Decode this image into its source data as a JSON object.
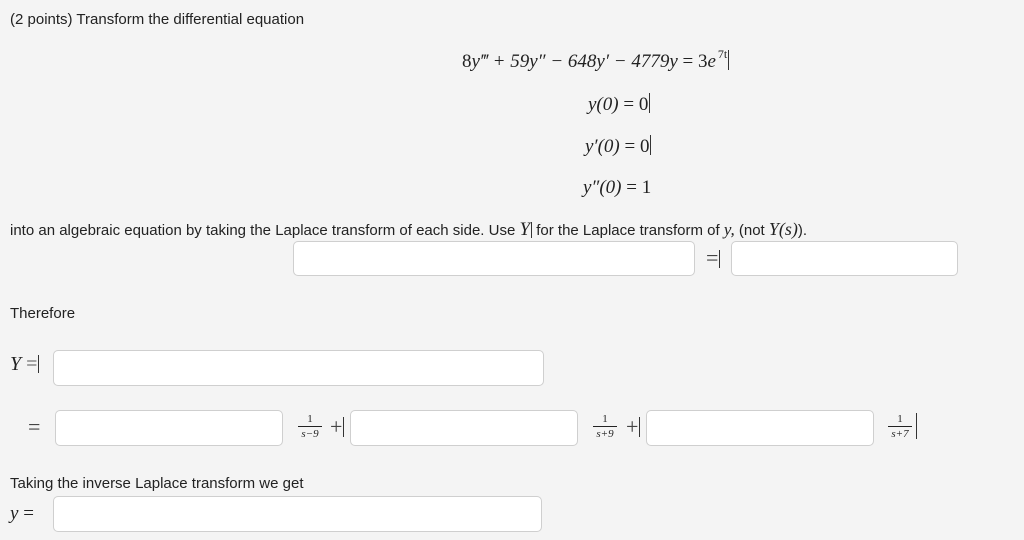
{
  "problem": {
    "intro": "(2 points) Transform the differential equation",
    "equation": {
      "lhs_a": "8",
      "lhs_b": "y‴ + 59",
      "lhs_c": "y″ − 648",
      "lhs_d": "y′ − 4779",
      "lhs_e": "y",
      "eq": " = 3",
      "rhs_e": "e",
      "exponent": "7t"
    },
    "conditions": [
      {
        "lhs": "y(0)",
        "rhs": "0"
      },
      {
        "lhs": "y′(0)",
        "rhs": "0"
      },
      {
        "lhs": "y″(0)",
        "rhs": "1"
      }
    ],
    "instruction_a": "into an algebraic equation by taking the Laplace transform of each side. Use",
    "instruction_Y": "Y",
    "instruction_b": "for the Laplace transform of",
    "instruction_y": "y,",
    "instruction_c": "(not",
    "instruction_Ys": "Y(s)",
    "instruction_d": ")."
  },
  "laplace_equation": {
    "lhs_value": "",
    "equals": "=",
    "rhs_value": ""
  },
  "therefore_label": "Therefore",
  "Y_row": {
    "label": "Y",
    "equals": "=",
    "value": ""
  },
  "partial_fractions": {
    "equals": "=",
    "terms": [
      {
        "value": "",
        "num": "1",
        "den": "s−9",
        "plus": "+"
      },
      {
        "value": "",
        "num": "1",
        "den": "s+9",
        "plus": "+"
      },
      {
        "value": "",
        "num": "1",
        "den": "s+7",
        "plus": ""
      }
    ]
  },
  "inverse": {
    "label": "Taking the inverse Laplace transform we get",
    "var": "y",
    "equals": "=",
    "value": ""
  }
}
